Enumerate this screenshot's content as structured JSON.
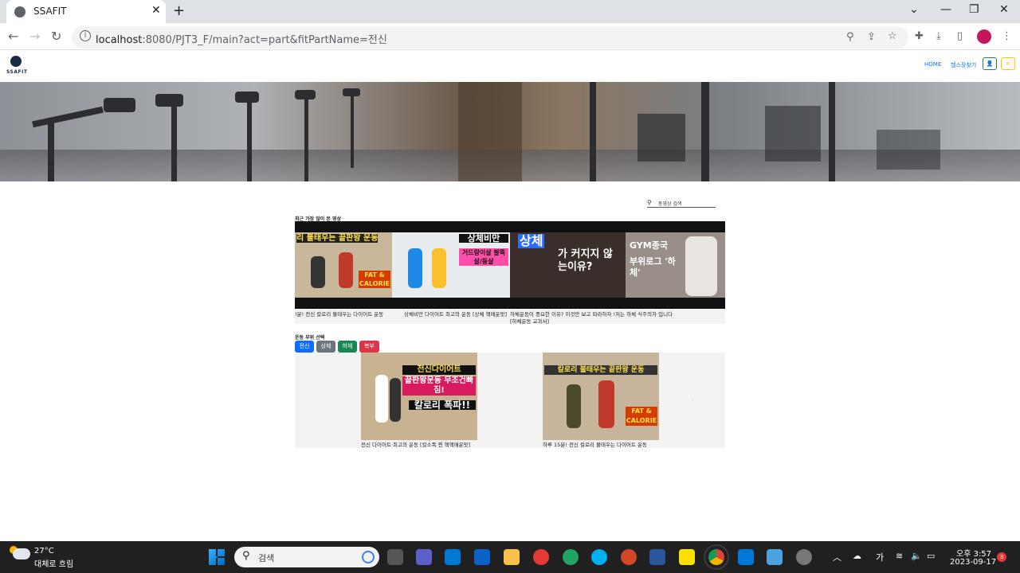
{
  "browser": {
    "tab_title": "SSAFIT",
    "tab_close": "✕",
    "new_tab": "+",
    "url_host": "localhost",
    "url_rest": ":8080/PJT3_F/main?act=part&fitPartName=전신"
  },
  "site": {
    "logo_text": "SSAFIT",
    "nav": {
      "home": "HOME",
      "find_gym": "헬스장찾기"
    },
    "user_btn": "👤",
    "menu_btn": "≡"
  },
  "search": {
    "placeholder": "동영상 검색"
  },
  "recent": {
    "label": "최근 가장 많이 본 영상",
    "slides": [
      {
        "line1": "리 불태우는 끝판왕 운동",
        "line2": "FAT & CALORIE"
      },
      {
        "line1": "상체비만",
        "line2": "거드랑이살 팔뚝살/등살"
      },
      {
        "line1": "상체",
        "line2": "가 커지지 않는이유?"
      },
      {
        "line1": "GYM종국",
        "line2": "부위로그 '하체'"
      }
    ],
    "captions": [
      "!분! 전신 칼로리 불태우는 다이어트 운동",
      "상체비만 다이어트 최고의 운동 [상체 핵매운맛]",
      "하체운동이 중요한 이유? 이것만 보고 따라하자 !저는 하체 식주의자 입니다",
      "[하체운동 교과서]"
    ]
  },
  "parts": {
    "label": "운동 부위 선택",
    "buttons": [
      "전신",
      "상체",
      "하체",
      "복부"
    ],
    "colors": [
      "#0d6efd",
      "#6c757d",
      "#198754",
      "#dc3545"
    ]
  },
  "videos": [
    {
      "thumb_line1": "전신다이어트",
      "thumb_line2": "끝판왕운동 무조건빠짐!",
      "thumb_line3": "칼로리 폭파!!",
      "caption": "전신 다이어트 최고의 운동 [칼소폭 찐 핵핵매운맛]"
    },
    {
      "thumb_line1": "칼로리 불태우는 끝판왕 운동",
      "thumb_line2": "FAT & CALORIE",
      "thumb_line3": "",
      "caption": "하루 15분! 전신 칼로리 불태우는 다이어트 운동"
    }
  ],
  "taskbar": {
    "temp": "27°C",
    "weather": "대체로 흐림",
    "search": "검색",
    "ime": "가",
    "time": "오후 3:57",
    "date": "2023-09-17",
    "notif_count": "3"
  }
}
